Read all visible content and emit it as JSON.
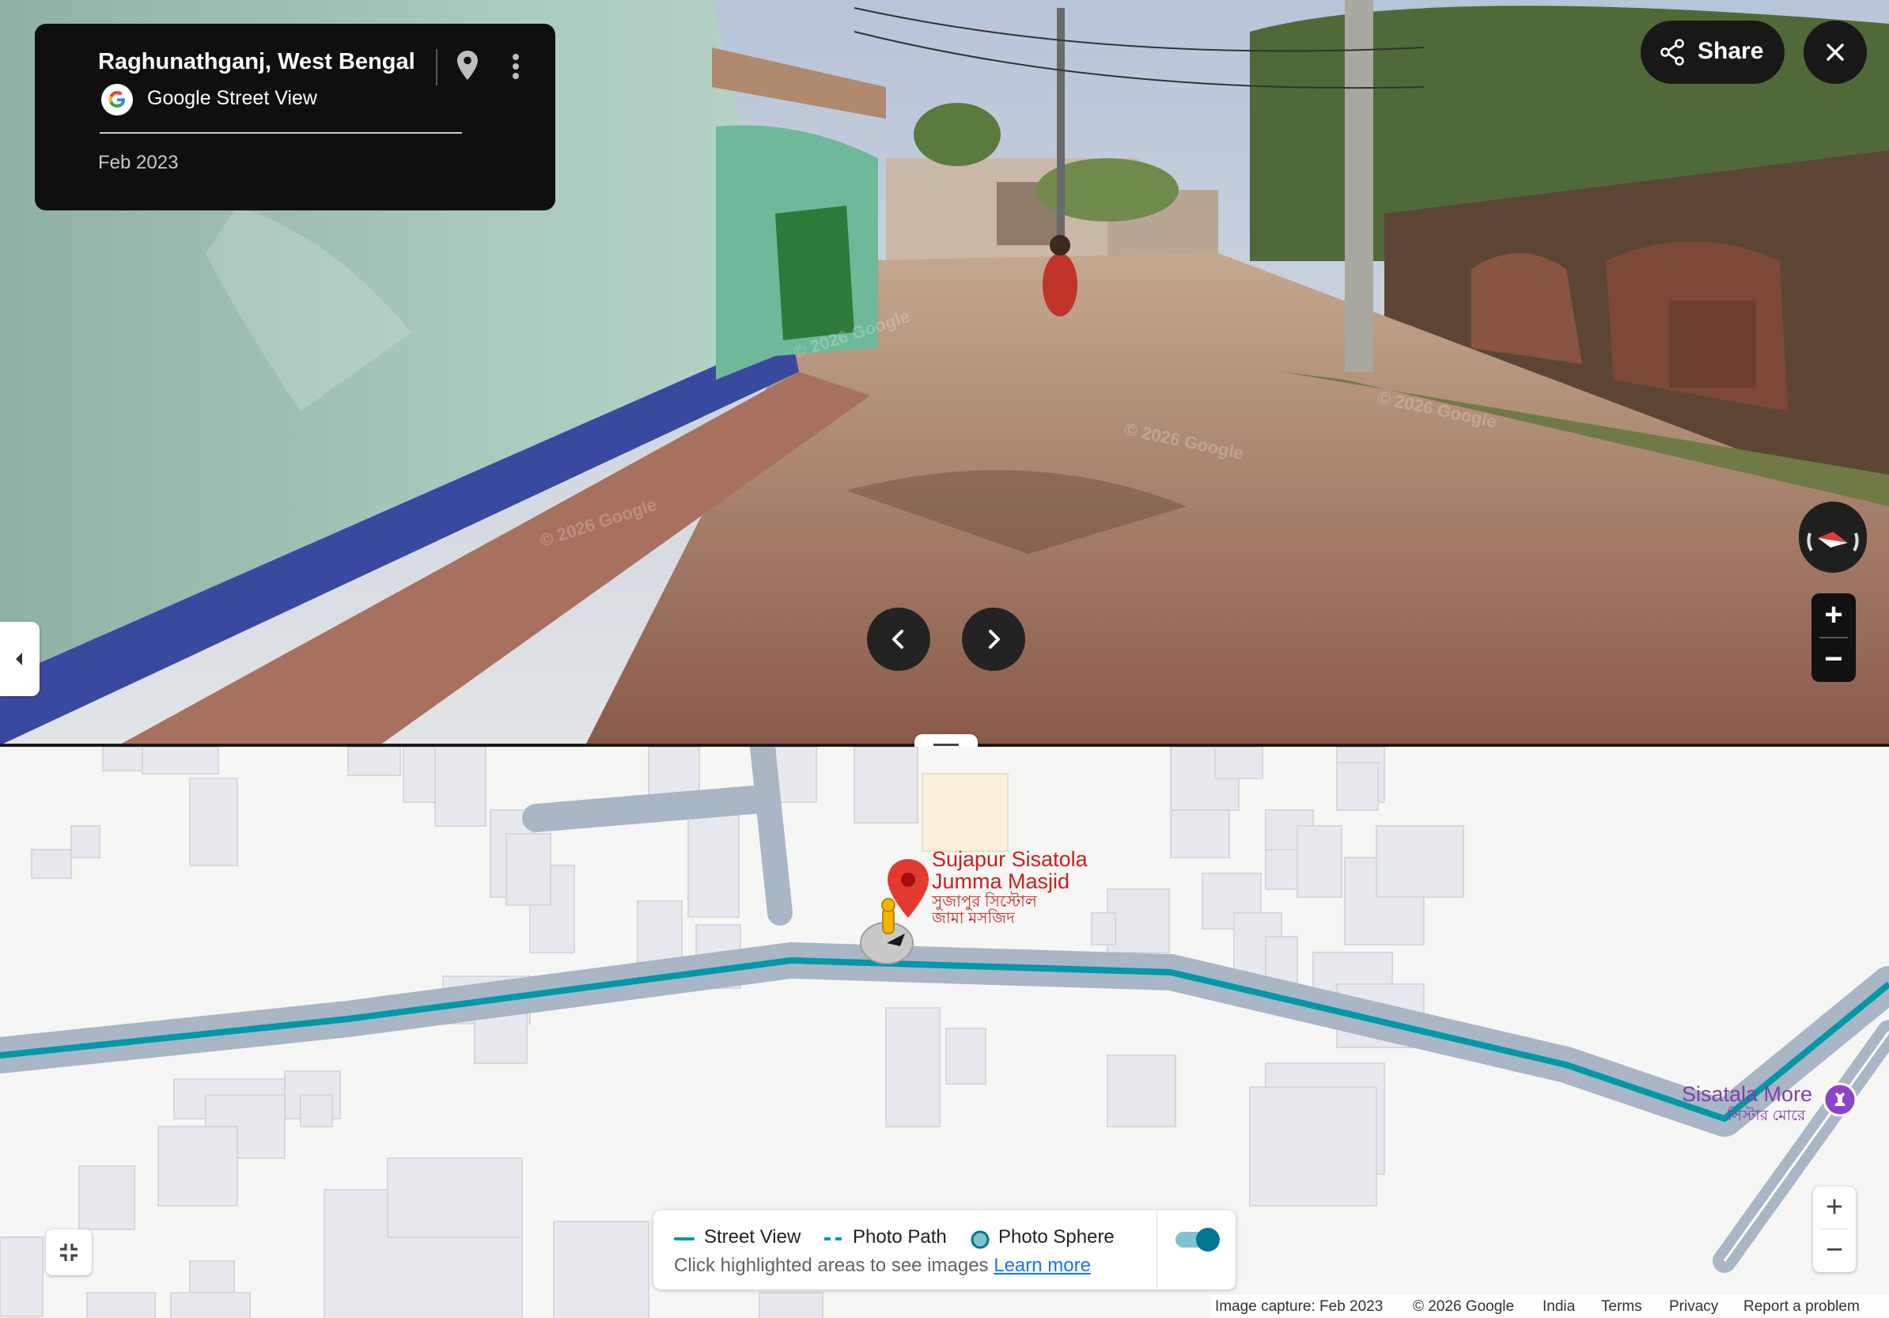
{
  "info_card": {
    "title": "Raghunathganj, West Bengal",
    "source": "Google Street View",
    "date": "Feb 2023"
  },
  "icons": {
    "pin": "location-pin-icon",
    "more": "more-vertical-icon",
    "share": "share-icon",
    "close": "close-icon",
    "prev": "chevron-left-icon",
    "next": "chevron-right-icon",
    "collapse": "caret-left-icon",
    "fullscreen": "exit-fullscreen-icon"
  },
  "toolbar": {
    "share_label": "Share"
  },
  "pano_controls": {
    "zoom_in": "+",
    "zoom_out": "−"
  },
  "watermarks": [
    "© 2026 Google",
    "© 2026 Google",
    "© 2026 Google",
    "© 2026 Google"
  ],
  "map": {
    "poi": {
      "name_line1": "Sujapur Sisatola",
      "name_line2": "Jumma Masjid",
      "local_line1": "সুজাপুর সিস্টোল",
      "local_line2": "জামা মসজিদ"
    },
    "place": {
      "name": "Sisatala More",
      "local": "সিস্টার মোরে"
    },
    "zoom_in": "+",
    "zoom_out": "−"
  },
  "legend": {
    "street_view": "Street View",
    "photo_path": "Photo Path",
    "photo_sphere": "Photo Sphere",
    "hint": "Click highlighted areas to see images",
    "learn_more": "Learn more",
    "toggle_on": true
  },
  "footer": {
    "capture": "Image capture: Feb 2023",
    "copyright": "© 2026 Google",
    "country": "India",
    "terms": "Terms",
    "privacy": "Privacy",
    "report": "Report a problem"
  },
  "colors": {
    "street_view_line": "#0097a7",
    "road": "#a9b6c6",
    "poi": "#c5221f",
    "place": "#8040a8"
  }
}
